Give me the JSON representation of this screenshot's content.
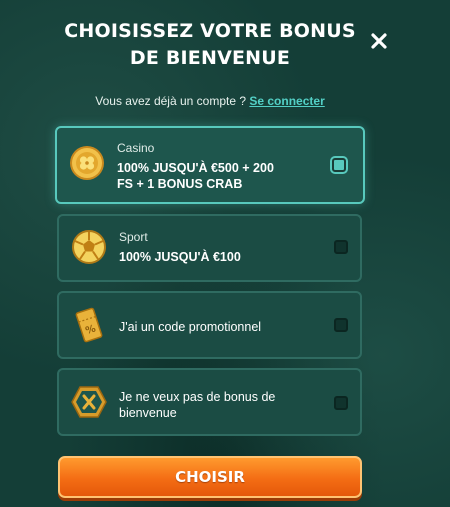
{
  "modal": {
    "title_line1": "CHOISISSEZ VOTRE BONUS",
    "title_line2": "DE BIENVENUE",
    "close_icon": "close-icon"
  },
  "login": {
    "prompt": "Vous avez déjà un compte ?",
    "link": "Se connecter"
  },
  "options": [
    {
      "label": "Casino",
      "line1": "100% JUSQU'À €500 + 200",
      "line2": "FS + 1 BONUS CRAB",
      "icon": "clover-coin-icon",
      "selected": true
    },
    {
      "label": "Sport",
      "line1": "100% JUSQU'À €100",
      "icon": "soccer-ball-icon",
      "selected": false
    },
    {
      "line1": "J'ai un code promotionnel",
      "icon": "promo-ticket-icon",
      "selected": false
    },
    {
      "line1": "Je ne veux pas de bonus de",
      "line2": "bienvenue",
      "icon": "no-bonus-icon",
      "selected": false
    }
  ],
  "cta": {
    "label": "CHOISIR"
  },
  "colors": {
    "background": "#143e37",
    "card": "#1b4c44",
    "accent": "#58c9bd",
    "button": "#f46d14"
  }
}
